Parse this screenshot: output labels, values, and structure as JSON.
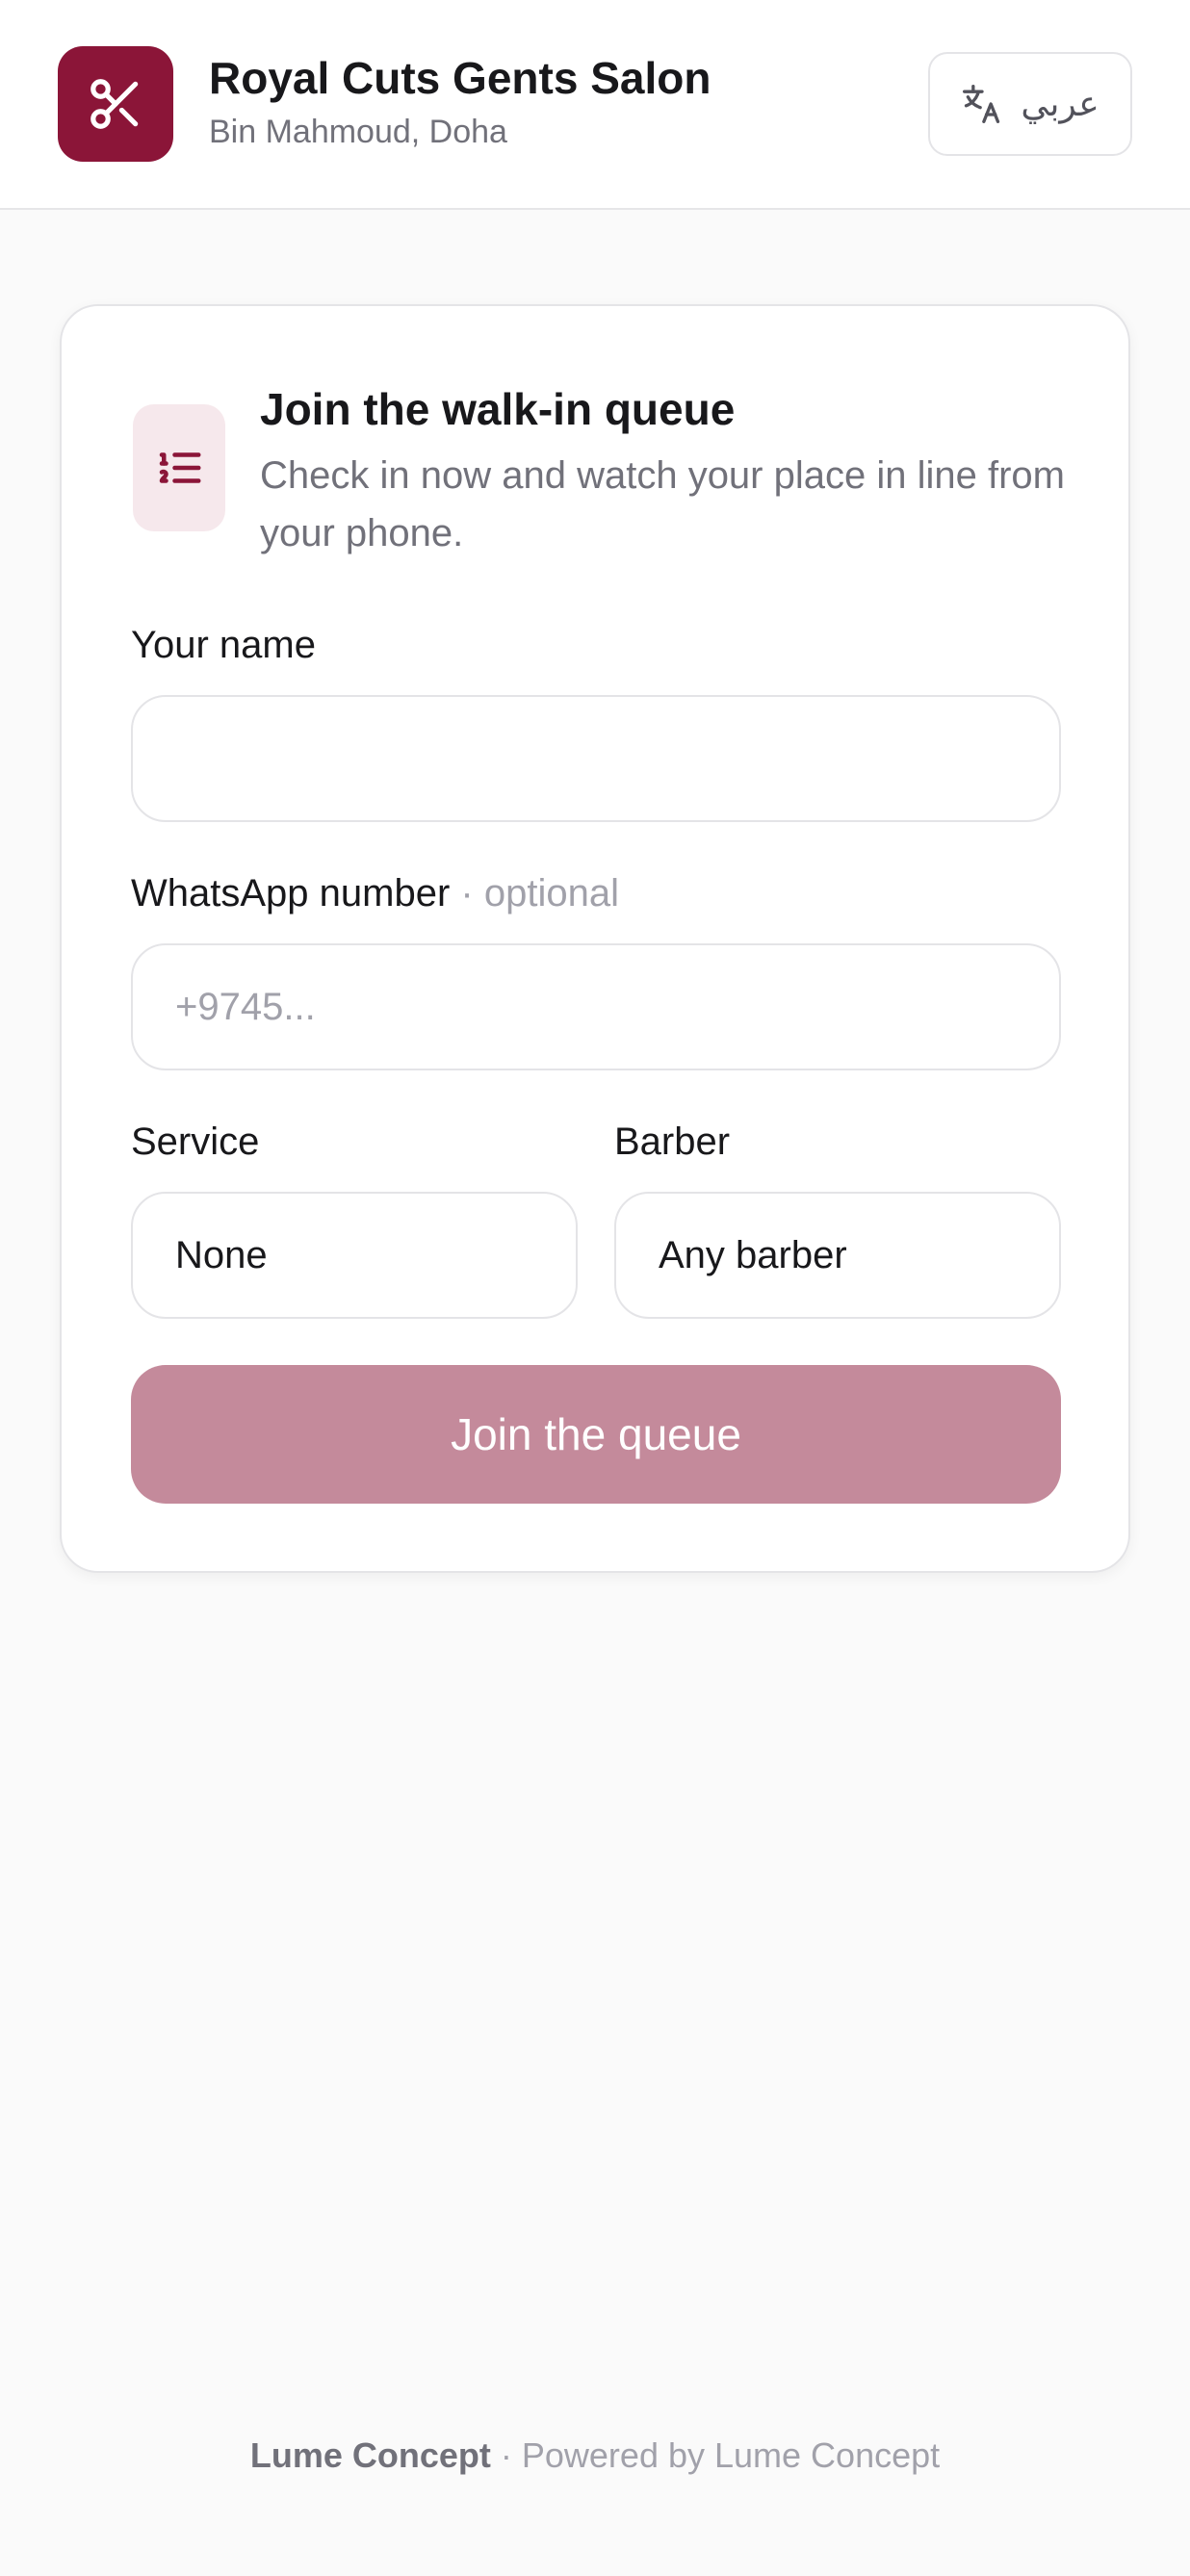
{
  "header": {
    "brand_name": "Royal Cuts Gents Salon",
    "location": "Bin Mahmoud, Doha",
    "logo_icon": "scissors-icon",
    "language_toggle": {
      "icon": "translate-icon",
      "label": "عربي"
    }
  },
  "card": {
    "icon": "numbered-list-icon",
    "title": "Join the walk-in queue",
    "subtitle": "Check in now and watch your place in line from your phone.",
    "fields": {
      "name": {
        "label": "Your name",
        "value": "",
        "placeholder": ""
      },
      "whatsapp": {
        "label": "WhatsApp number",
        "optional_tag": "· optional",
        "value": "",
        "placeholder": "+9745..."
      },
      "service": {
        "label": "Service",
        "selected": "None"
      },
      "barber": {
        "label": "Barber",
        "selected": "Any barber"
      }
    },
    "submit_label": "Join the queue"
  },
  "footer": {
    "brand": "Lume Concept",
    "powered_by": "· Powered by Lume Concept"
  },
  "colors": {
    "brand": "#8b1538",
    "brand_soft": "#f6e8ec",
    "button_disabled": "#c48a9b",
    "text_primary": "#18181b",
    "text_muted": "#71717a",
    "text_placeholder": "#a1a1aa",
    "border": "#e4e4e7",
    "background": "#fafafa"
  }
}
